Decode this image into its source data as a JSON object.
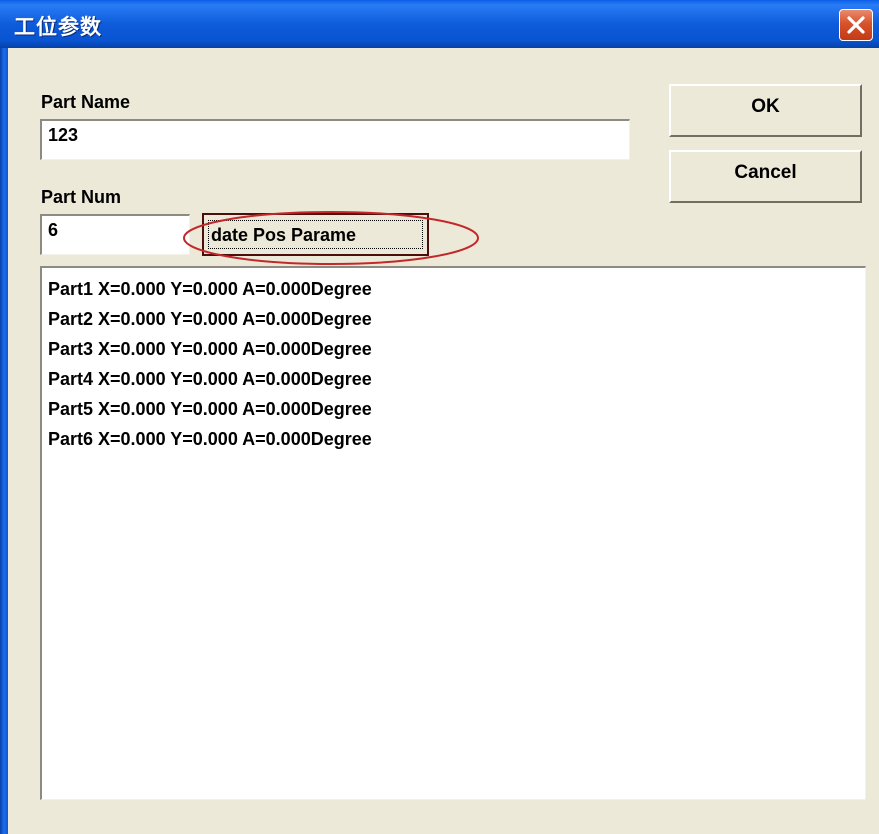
{
  "window": {
    "title": "工位参数"
  },
  "icons": {
    "close": "close-icon"
  },
  "colors": {
    "titlebar": "#0A5FE8",
    "close": "#D8522C",
    "dialog_bg": "#ECE9D8",
    "highlight_ellipse": "#C2282A"
  },
  "form": {
    "part_name_label": "Part Name",
    "part_name_value": "123",
    "part_num_label": "Part Num",
    "part_num_value": "6",
    "update_button": "date Pos Parame"
  },
  "buttons": {
    "ok": "OK",
    "cancel": "Cancel"
  },
  "list": {
    "items": [
      "Part1 X=0.000 Y=0.000 A=0.000Degree",
      "Part2 X=0.000 Y=0.000 A=0.000Degree",
      "Part3 X=0.000 Y=0.000 A=0.000Degree",
      "Part4 X=0.000 Y=0.000 A=0.000Degree",
      "Part5 X=0.000 Y=0.000 A=0.000Degree",
      "Part6 X=0.000 Y=0.000 A=0.000Degree"
    ]
  }
}
